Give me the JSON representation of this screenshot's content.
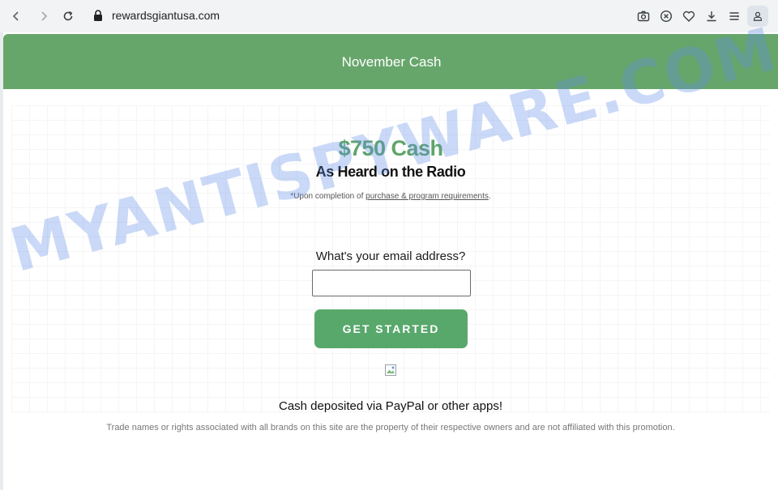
{
  "browser": {
    "url": "rewardsgiantusa.com",
    "icons": {
      "back": "chevron-left-icon",
      "forward": "chevron-right-icon",
      "reload": "reload-icon",
      "lock": "lock-icon",
      "screenshot": "camera-icon",
      "block": "close-circle-icon",
      "favorite": "heart-icon",
      "download": "download-icon",
      "menu": "menu-icon",
      "profile": "user-icon"
    }
  },
  "banner": {
    "title": "November Cash",
    "color": "#67a66b"
  },
  "offer": {
    "price": "$750 Cash",
    "subtitle": "As Heard on the Radio",
    "fineprint_prefix": "*Upon completion of ",
    "fineprint_link": "purchase & program requirements",
    "fineprint_suffix": "."
  },
  "form": {
    "email_label": "What's your email address?",
    "email_value": "",
    "cta_label": "GET STARTED",
    "cta_color": "#58a86b"
  },
  "footer": {
    "deposit_text": "Cash deposited via PayPal or other apps!",
    "disclaimer": "Trade names or rights associated with all brands on this site are the property of their respective owners and are not affiliated with this promotion."
  },
  "watermark": {
    "text": "MYANTISPYWARE.COM"
  }
}
